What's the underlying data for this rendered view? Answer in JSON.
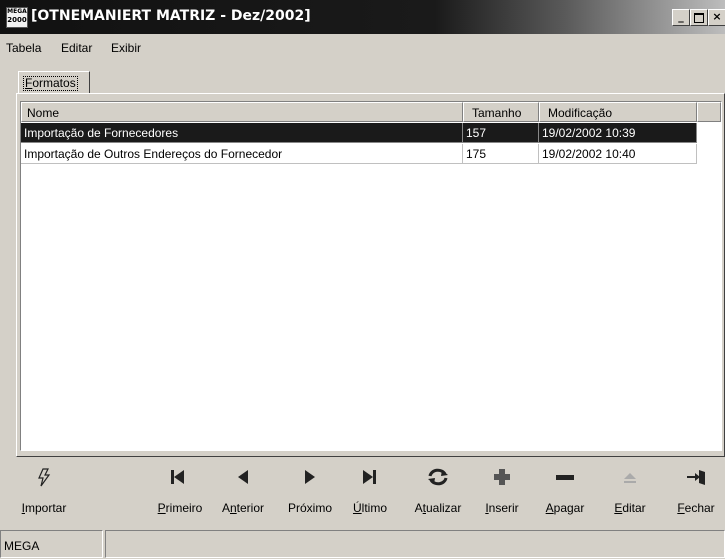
{
  "window": {
    "title": "[OTNEMANIERT MATRIZ - Dez/2002]",
    "app_icon_text": "2000",
    "minimize_icon": "minimize-icon",
    "maximize_icon": "maximize-icon",
    "close_icon": "close-icon"
  },
  "menu": {
    "items": [
      "Tabela",
      "Editar",
      "Exibir"
    ]
  },
  "tab": {
    "label": "Formatos",
    "accel": "F",
    "rest": "ormatos"
  },
  "table": {
    "columns": [
      "Nome",
      "Tamanho",
      "Modificação"
    ],
    "rows": [
      {
        "nome": "Importação de Fornecedores",
        "tamanho": "157",
        "modificacao": "19/02/2002 10:39",
        "selected": true
      },
      {
        "nome": "Importação de Outros Endereços do Fornecedor",
        "tamanho": "175",
        "modificacao": "19/02/2002 10:40",
        "selected": false
      }
    ]
  },
  "toolbar": {
    "buttons": [
      {
        "name": "importar",
        "accel": "I",
        "rest": "mportar",
        "icon": "lightning-icon",
        "enabled": true
      },
      {
        "name": "primeiro",
        "accel": "P",
        "rest": "rimeiro",
        "icon": "first-icon",
        "enabled": true
      },
      {
        "name": "anterior",
        "pre": "A",
        "accel": "n",
        "rest": "terior",
        "icon": "previous-icon",
        "enabled": true
      },
      {
        "name": "proximo",
        "label": "Próximo",
        "icon": "next-icon",
        "enabled": true
      },
      {
        "name": "ultimo",
        "accel": "Ú",
        "rest": "ltimo",
        "icon": "last-icon",
        "enabled": true
      },
      {
        "name": "atualizar",
        "pre": "A",
        "accel": "t",
        "rest": "ualizar",
        "icon": "refresh-icon",
        "enabled": true
      },
      {
        "name": "inserir",
        "accel": "I",
        "rest": "nserir",
        "icon": "plus-icon",
        "enabled": true
      },
      {
        "name": "apagar",
        "accel": "A",
        "rest": "pagar",
        "icon": "minus-icon",
        "enabled": true
      },
      {
        "name": "editar",
        "accel": "E",
        "rest": "ditar",
        "icon": "eject-icon",
        "enabled": true
      },
      {
        "name": "fechar",
        "accel": "F",
        "rest": "echar",
        "icon": "exit-door-icon",
        "enabled": true
      }
    ]
  },
  "status": {
    "left": "MEGA",
    "right": ""
  }
}
